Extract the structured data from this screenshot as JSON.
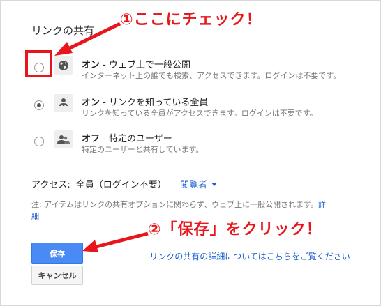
{
  "dialog": {
    "heading": "リンクの共有"
  },
  "options": [
    {
      "title_bold": "オン",
      "title_rest": " - ウェブ上で一般公開",
      "description": "インターネット上の誰でも検索、アクセスできます。ログインは不要です。",
      "icon": "globe-icon",
      "selected": false
    },
    {
      "title_bold": "オン",
      "title_rest": " - リンクを知っている全員",
      "description": "リンクを知っている全員がアクセスできます。ログインは不要です。",
      "icon": "person-link-icon",
      "selected": true
    },
    {
      "title_bold": "オフ",
      "title_rest": " - 特定のユーザー",
      "description": "特定のユーザーと共有しています。",
      "icon": "people-icon",
      "selected": false
    }
  ],
  "access": {
    "label": "アクセス:",
    "value": "全員（ログイン不要）",
    "role": "閲覧者"
  },
  "note": {
    "text": "注: アイテムはリンクの共有オプションに関わらず、ウェブ上に一般公開されます。",
    "link": "詳細"
  },
  "buttons": {
    "save": "保存",
    "cancel": "キャンセル"
  },
  "details_link": "リンクの共有の詳細についてはこちらをご覧ください",
  "annotations": {
    "callout1": "①ここにチェック！",
    "callout2": "②「保存」をクリック！",
    "color": "#e8161b"
  }
}
